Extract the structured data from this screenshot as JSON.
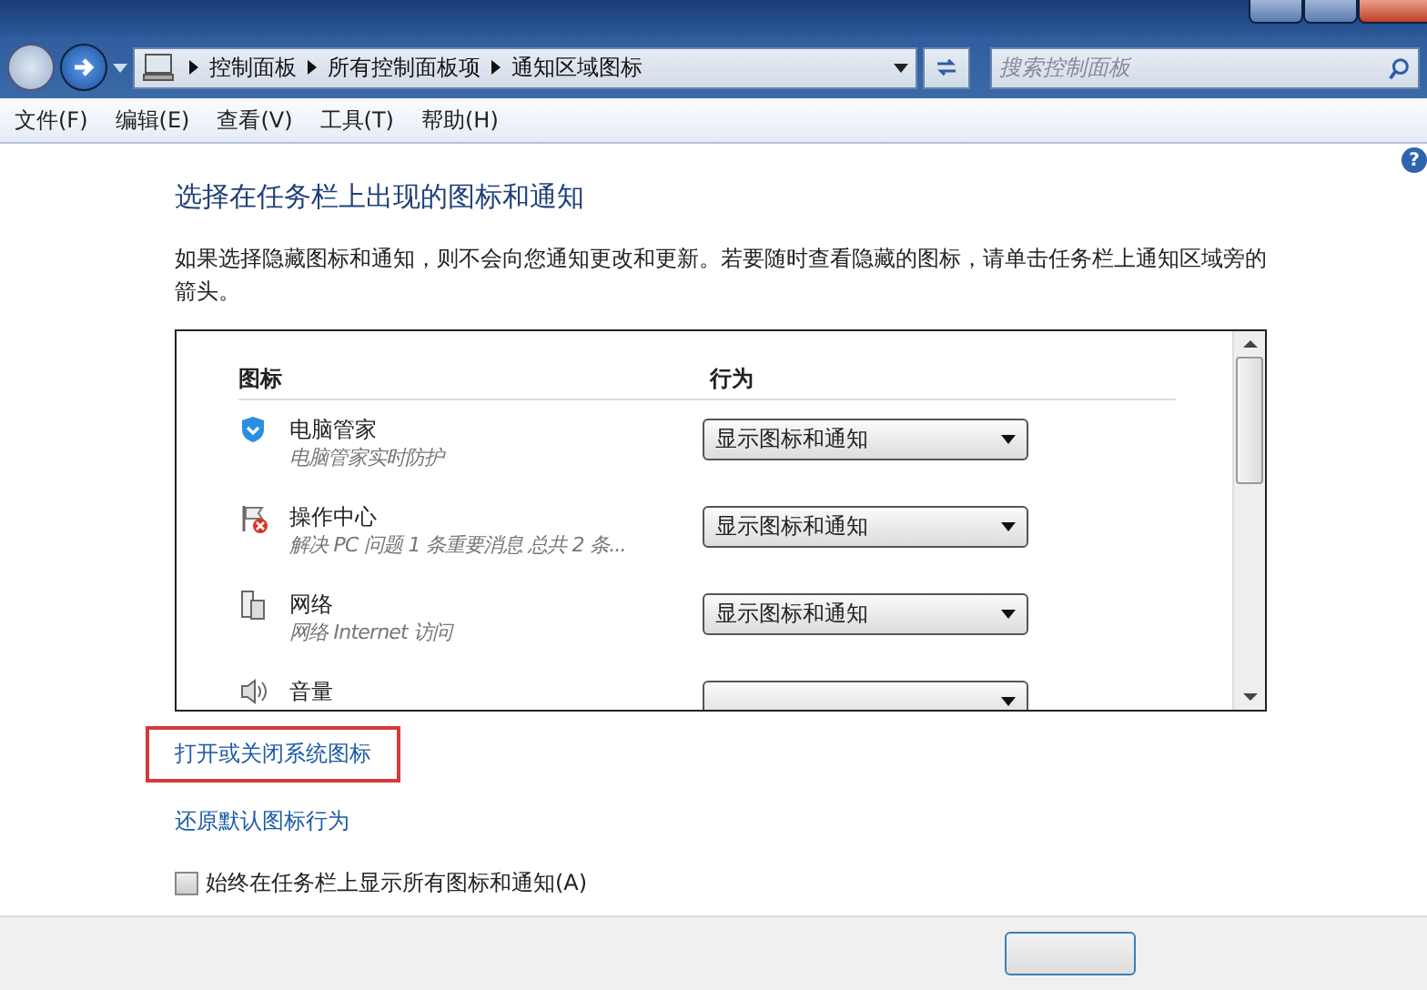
{
  "address_bar": {
    "path": [
      "控制面板",
      "所有控制面板项",
      "通知区域图标"
    ]
  },
  "search": {
    "placeholder": "搜索控制面板"
  },
  "help": "?",
  "menu": [
    "文件(F)",
    "编辑(E)",
    "查看(V)",
    "工具(T)",
    "帮助(H)"
  ],
  "heading": "选择在任务栏上出现的图标和通知",
  "description": "如果选择隐藏图标和通知，则不会向您通知更改和更新。若要随时查看隐藏的图标，请单击任务栏上通知区域旁的箭头。",
  "table": {
    "columns": [
      "图标",
      "行为"
    ],
    "rows": [
      {
        "kind": "shield",
        "name": "电脑管家",
        "detail": "电脑管家实时防护",
        "behavior": "显示图标和通知"
      },
      {
        "kind": "flag",
        "name": "操作中心",
        "detail": "解决 PC 问题 1 条重要消息 总共 2 条...",
        "behavior": "显示图标和通知"
      },
      {
        "kind": "network",
        "name": "网络",
        "detail": "网络 Internet 访问",
        "behavior": "显示图标和通知"
      },
      {
        "kind": "speaker",
        "name": "音量"
      }
    ]
  },
  "links": [
    {
      "text": "打开或关闭系统图标",
      "highlighted": true
    },
    {
      "text": "还原默认图标行为",
      "highlighted": false
    }
  ],
  "always_show": {
    "label": "始终在任务栏上显示所有图标和通知(A)",
    "checked": false
  }
}
